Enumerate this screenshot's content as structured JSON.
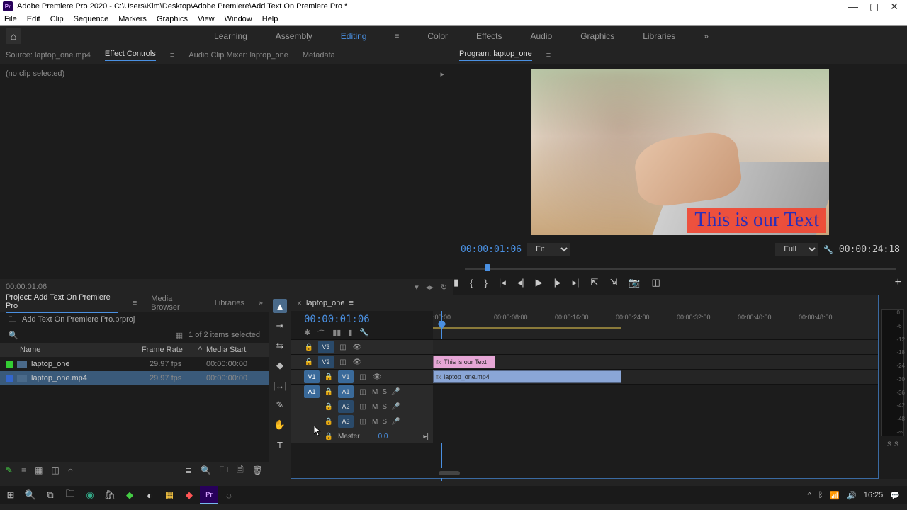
{
  "titlebar": {
    "icon_label": "Pr",
    "title": "Adobe Premiere Pro 2020 - C:\\Users\\Kim\\Desktop\\Adobe Premiere\\Add Text On Premiere Pro *"
  },
  "menubar": [
    "File",
    "Edit",
    "Clip",
    "Sequence",
    "Markers",
    "Graphics",
    "View",
    "Window",
    "Help"
  ],
  "workspaces": [
    "Learning",
    "Assembly",
    "Editing",
    "Color",
    "Effects",
    "Audio",
    "Graphics",
    "Libraries"
  ],
  "workspace_active": "Editing",
  "source_tabs": {
    "source": "Source: laptop_one.mp4",
    "effect": "Effect Controls",
    "mixer": "Audio Clip Mixer: laptop_one",
    "meta": "Metadata"
  },
  "effect_panel": {
    "no_clip": "(no clip selected)",
    "timecode": "00:00:01:06"
  },
  "program": {
    "tab": "Program: laptop_one",
    "overlay_text": "This is our Text",
    "tc_left": "00:00:01:06",
    "fit": "Fit",
    "quality": "Full",
    "tc_right": "00:00:24:18"
  },
  "project": {
    "tabs": {
      "project": "Project: Add Text On Premiere Pro",
      "media": "Media Browser",
      "libraries": "Libraries"
    },
    "filename": "Add Text On Premiere Pro.prproj",
    "selection": "1 of 2 items selected",
    "cols": {
      "name": "Name",
      "rate": "Frame Rate",
      "start": "Media Start"
    },
    "items": [
      {
        "name": "laptop_one",
        "rate": "29.97 fps",
        "start": "00:00:00:00",
        "selected": false
      },
      {
        "name": "laptop_one.mp4",
        "rate": "29.97 fps",
        "start": "00:00:00:00",
        "selected": true
      }
    ]
  },
  "timeline": {
    "seq_name": "laptop_one",
    "tc": "00:00:01:06",
    "ruler": [
      ":00:00",
      "00:00:08:00",
      "00:00:16:00",
      "00:00:24:00",
      "00:00:32:00",
      "00:00:40:00",
      "00:00:48:00"
    ],
    "tracks": {
      "v3": "V3",
      "v2": "V2",
      "v1": "V1",
      "a1": "A1",
      "a2": "A2",
      "a3": "A3",
      "master": "Master",
      "master_val": "0.0",
      "src_v": "V1",
      "src_a": "A1"
    },
    "clips": {
      "text": "This is our Text",
      "video": "laptop_one.mp4"
    }
  },
  "meters": {
    "ticks": [
      "0",
      "-6",
      "-12",
      "-18",
      "-24",
      "-30",
      "-36",
      "-42",
      "-48",
      "-∞"
    ],
    "s1": "S",
    "s2": "S"
  },
  "taskbar": {
    "time": "16:25"
  }
}
